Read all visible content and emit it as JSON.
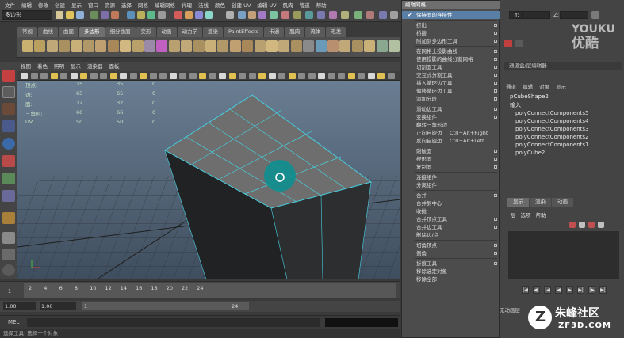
{
  "menubar": [
    "文件",
    "编辑",
    "修改",
    "创建",
    "显示",
    "窗口",
    "资源",
    "选择",
    "网格",
    "编辑网格",
    "代理",
    "法线",
    "颜色",
    "创建 UV",
    "编辑 UV",
    "肌肉",
    "管道",
    "帮助"
  ],
  "status": {
    "mode": "多边形",
    "field_y": "Y:",
    "field_z": "Z:"
  },
  "shelf_tabs": [
    {
      "label": "常规",
      "active": false
    },
    {
      "label": "曲线",
      "active": false
    },
    {
      "label": "曲面",
      "active": false
    },
    {
      "label": "多边形",
      "active": true
    },
    {
      "label": "细分曲面",
      "active": false
    },
    {
      "label": "变形",
      "active": false
    },
    {
      "label": "动画",
      "active": false
    },
    {
      "label": "动力学",
      "active": false
    },
    {
      "label": "渲染",
      "active": false
    },
    {
      "label": "PaintEffects",
      "active": false
    },
    {
      "label": "卡通",
      "active": false
    },
    {
      "label": "肌肉",
      "active": false
    },
    {
      "label": "流体",
      "active": false
    },
    {
      "label": "毛发",
      "active": false
    }
  ],
  "panel_menu": [
    "视图",
    "着色",
    "照明",
    "显示",
    "渲染器",
    "面板"
  ],
  "hud": {
    "rows": [
      {
        "label": "顶点:",
        "a": "35",
        "b": "35",
        "c": "0"
      },
      {
        "label": "边:",
        "a": "65",
        "b": "65",
        "c": "0"
      },
      {
        "label": "面:",
        "a": "32",
        "b": "32",
        "c": "0"
      },
      {
        "label": "三角形:",
        "a": "66",
        "b": "66",
        "c": "0"
      },
      {
        "label": "UV:",
        "a": "50",
        "b": "50",
        "c": "0"
      }
    ]
  },
  "timeline": {
    "ticks": [
      "2",
      "4",
      "6",
      "8",
      "10",
      "12",
      "14",
      "16",
      "18",
      "20",
      "22",
      "24"
    ],
    "current": "1"
  },
  "range": {
    "start": "1.00",
    "start2": "1.00",
    "in": "1",
    "out": "24"
  },
  "mel": {
    "label": "MEL"
  },
  "helpline": "选择工具: 选择一个对象",
  "menu": {
    "title": "编辑网格",
    "items": [
      {
        "label": "保持面的连接性",
        "check": true,
        "highlight": true
      },
      {
        "sep": true
      },
      {
        "label": "挤出",
        "opt": true
      },
      {
        "label": "桥接",
        "opt": true
      },
      {
        "label": "附加到多边形工具",
        "opt": true
      },
      {
        "sep": true
      },
      {
        "label": "在网格上投影曲线",
        "opt": true
      },
      {
        "label": "使用投影的曲线分割网格",
        "opt": true
      },
      {
        "label": "切割面工具",
        "opt": true
      },
      {
        "label": "交互式分割工具",
        "opt": true
      },
      {
        "label": "插入循环边工具",
        "opt": true
      },
      {
        "label": "偏移循环边工具",
        "opt": true
      },
      {
        "label": "添加分段",
        "opt": true
      },
      {
        "sep": true
      },
      {
        "label": "滑动边工具",
        "opt": true
      },
      {
        "label": "变换组件",
        "opt": true
      },
      {
        "label": "翻转三角形边",
        "opt": false
      },
      {
        "label": "正向自旋边",
        "shortcut": "Ctrl+Alt+Right",
        "opt": false
      },
      {
        "label": "反向自旋边",
        "shortcut": "Ctrl+Alt+Left",
        "opt": false
      },
      {
        "sep": true
      },
      {
        "label": "刺破面",
        "opt": true
      },
      {
        "label": "楔形面",
        "opt": true
      },
      {
        "label": "复制面",
        "opt": true
      },
      {
        "sep": true
      },
      {
        "label": "连接组件",
        "opt": false
      },
      {
        "label": "分离组件",
        "opt": false
      },
      {
        "sep": true
      },
      {
        "label": "合并",
        "opt": true
      },
      {
        "label": "合并到中心",
        "opt": false
      },
      {
        "label": "收拢",
        "opt": false
      },
      {
        "label": "合并顶点工具",
        "opt": true
      },
      {
        "label": "合并边工具",
        "opt": true
      },
      {
        "label": "删除边/点",
        "opt": false
      },
      {
        "sep": true
      },
      {
        "label": "切角顶点",
        "opt": true
      },
      {
        "label": "倒角",
        "opt": true
      },
      {
        "sep": true
      },
      {
        "label": "折痕工具",
        "opt": true
      },
      {
        "label": "移除选定对象",
        "opt": false
      },
      {
        "label": "移除全部",
        "opt": false
      }
    ]
  },
  "channel_box": {
    "header": "通道盒/层编辑器",
    "tabs": [
      "通道",
      "编辑",
      "对象",
      "显示"
    ],
    "shape": "pCubeShape2",
    "inputs_label": "输入",
    "inputs": [
      "polyConnectComponents5",
      "polyConnectComponents4",
      "polyConnectComponents3",
      "polyConnectComponents2",
      "polyConnectComponents1",
      "polyCube2"
    ],
    "layer_tabs": [
      "显示",
      "渲染",
      "动画"
    ],
    "layer_menu": [
      "层",
      "选项",
      "帮助"
    ],
    "anim_label": "无动画层"
  },
  "watermarks": {
    "youku": "YOUKU",
    "youku_cn": "优酷",
    "zf": "朱峰社区",
    "zf_url": "ZF3D.COM"
  },
  "colors": {
    "accent_select": "#5a7fa6",
    "wire_cyan": "#46d0e0",
    "manip": "#0e8f8f"
  }
}
